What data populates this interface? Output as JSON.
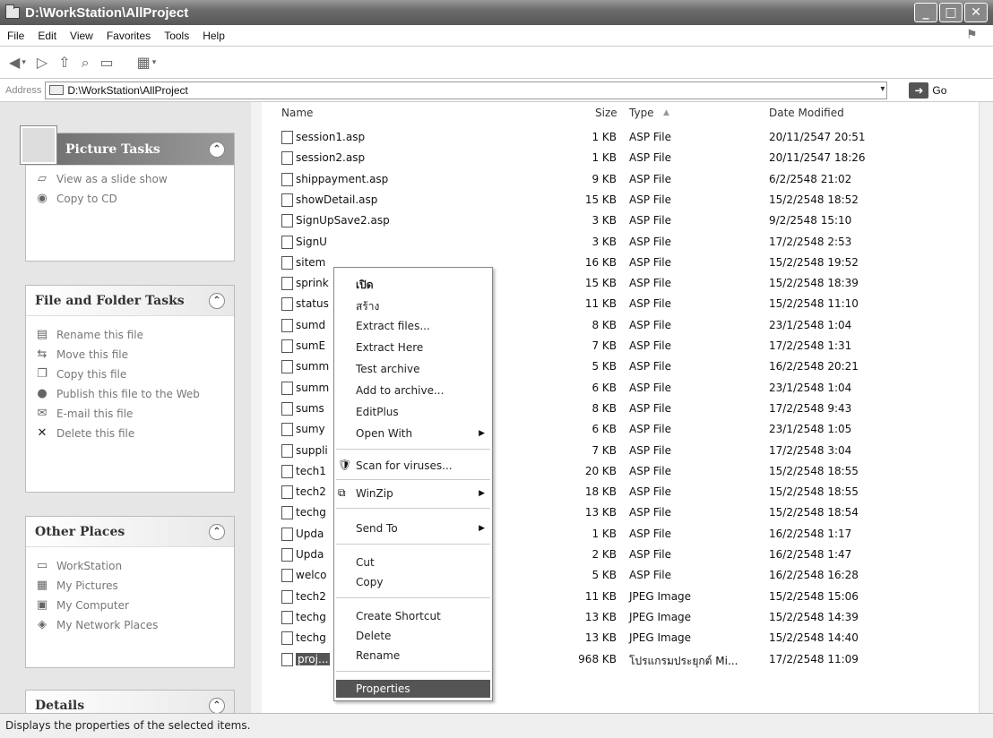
{
  "window": {
    "title": "D:\\WorkStation\\AllProject"
  },
  "menu": [
    "File",
    "Edit",
    "View",
    "Favorites",
    "Tools",
    "Help"
  ],
  "address": {
    "label": "Address",
    "value": "D:\\WorkStation\\AllProject",
    "go": "Go"
  },
  "sidebar": {
    "picture_tasks": {
      "title": "Picture Tasks",
      "items": [
        "View as a slide show",
        "Copy to CD"
      ]
    },
    "file_tasks": {
      "title": "File and Folder Tasks",
      "items": [
        "Rename this file",
        "Move this file",
        "Copy this file",
        "Publish this file to the Web",
        "E-mail this file",
        "Delete this file"
      ]
    },
    "other_places": {
      "title": "Other Places",
      "items": [
        "WorkStation",
        "My Pictures",
        "My Computer",
        "My Network Places"
      ]
    },
    "details": {
      "title": "Details"
    }
  },
  "columns": {
    "name": "Name",
    "size": "Size",
    "type": "Type",
    "date": "Date Modified"
  },
  "files": [
    {
      "name": "session1.asp",
      "size": "1 KB",
      "type": "ASP File",
      "date": "20/11/2547 20:51"
    },
    {
      "name": "session2.asp",
      "size": "1 KB",
      "type": "ASP File",
      "date": "20/11/2547 18:26"
    },
    {
      "name": "shippayment.asp",
      "size": "9 KB",
      "type": "ASP File",
      "date": "6/2/2548 21:02"
    },
    {
      "name": "showDetail.asp",
      "size": "15 KB",
      "type": "ASP File",
      "date": "15/2/2548 18:52"
    },
    {
      "name": "SignUpSave2.asp",
      "size": "3 KB",
      "type": "ASP File",
      "date": "9/2/2548 15:10"
    },
    {
      "name": "SignU",
      "size": "3 KB",
      "type": "ASP File",
      "date": "17/2/2548 2:53"
    },
    {
      "name": "sitem",
      "size": "16 KB",
      "type": "ASP File",
      "date": "15/2/2548 19:52"
    },
    {
      "name": "sprink",
      "size": "15 KB",
      "type": "ASP File",
      "date": "15/2/2548 18:39"
    },
    {
      "name": "status",
      "size": "11 KB",
      "type": "ASP File",
      "date": "15/2/2548 11:10"
    },
    {
      "name": "sumd",
      "size": "8 KB",
      "type": "ASP File",
      "date": "23/1/2548 1:04"
    },
    {
      "name": "sumE",
      "size": "7 KB",
      "type": "ASP File",
      "date": "17/2/2548 1:31"
    },
    {
      "name": "summ",
      "size": "5 KB",
      "type": "ASP File",
      "date": "16/2/2548 20:21"
    },
    {
      "name": "summ",
      "size": "6 KB",
      "type": "ASP File",
      "date": "23/1/2548 1:04"
    },
    {
      "name": "sums",
      "size": "8 KB",
      "type": "ASP File",
      "date": "17/2/2548 9:43"
    },
    {
      "name": "sumy",
      "size": "6 KB",
      "type": "ASP File",
      "date": "23/1/2548 1:05"
    },
    {
      "name": "suppli",
      "size": "7 KB",
      "type": "ASP File",
      "date": "17/2/2548 3:04"
    },
    {
      "name": "tech1",
      "size": "20 KB",
      "type": "ASP File",
      "date": "15/2/2548 18:55"
    },
    {
      "name": "tech2",
      "size": "18 KB",
      "type": "ASP File",
      "date": "15/2/2548 18:55"
    },
    {
      "name": "techg",
      "size": "13 KB",
      "type": "ASP File",
      "date": "15/2/2548 18:54"
    },
    {
      "name": "Upda",
      "size": "1 KB",
      "type": "ASP File",
      "date": "16/2/2548 1:17"
    },
    {
      "name": "Upda",
      "size": "2 KB",
      "type": "ASP File",
      "date": "16/2/2548 1:47"
    },
    {
      "name": "welco",
      "size": "5 KB",
      "type": "ASP File",
      "date": "16/2/2548 16:28"
    },
    {
      "name": "tech2",
      "size": "11 KB",
      "type": "JPEG Image",
      "date": "15/2/2548 15:06"
    },
    {
      "name": "techg",
      "size": "13 KB",
      "type": "JPEG Image",
      "date": "15/2/2548 14:39"
    },
    {
      "name": "techg",
      "size": "13 KB",
      "type": "JPEG Image",
      "date": "15/2/2548 14:40"
    },
    {
      "name": "proj...",
      "size": "968 KB",
      "type": "โปรแกรมประยุกต์ Mi...",
      "date": "17/2/2548 11:09"
    }
  ],
  "context_menu": {
    "open": "เปิด",
    "create": "สร้าง",
    "extract_files": "Extract files...",
    "extract_here": "Extract Here",
    "test_archive": "Test archive",
    "add_to_archive": "Add to archive...",
    "editplus": "EditPlus",
    "open_with": "Open With",
    "scan": "Scan for viruses...",
    "winzip": "WinZip",
    "send_to": "Send To",
    "cut": "Cut",
    "copy": "Copy",
    "create_shortcut": "Create Shortcut",
    "delete": "Delete",
    "rename": "Rename",
    "properties": "Properties"
  },
  "status": "Displays the properties of the selected items."
}
